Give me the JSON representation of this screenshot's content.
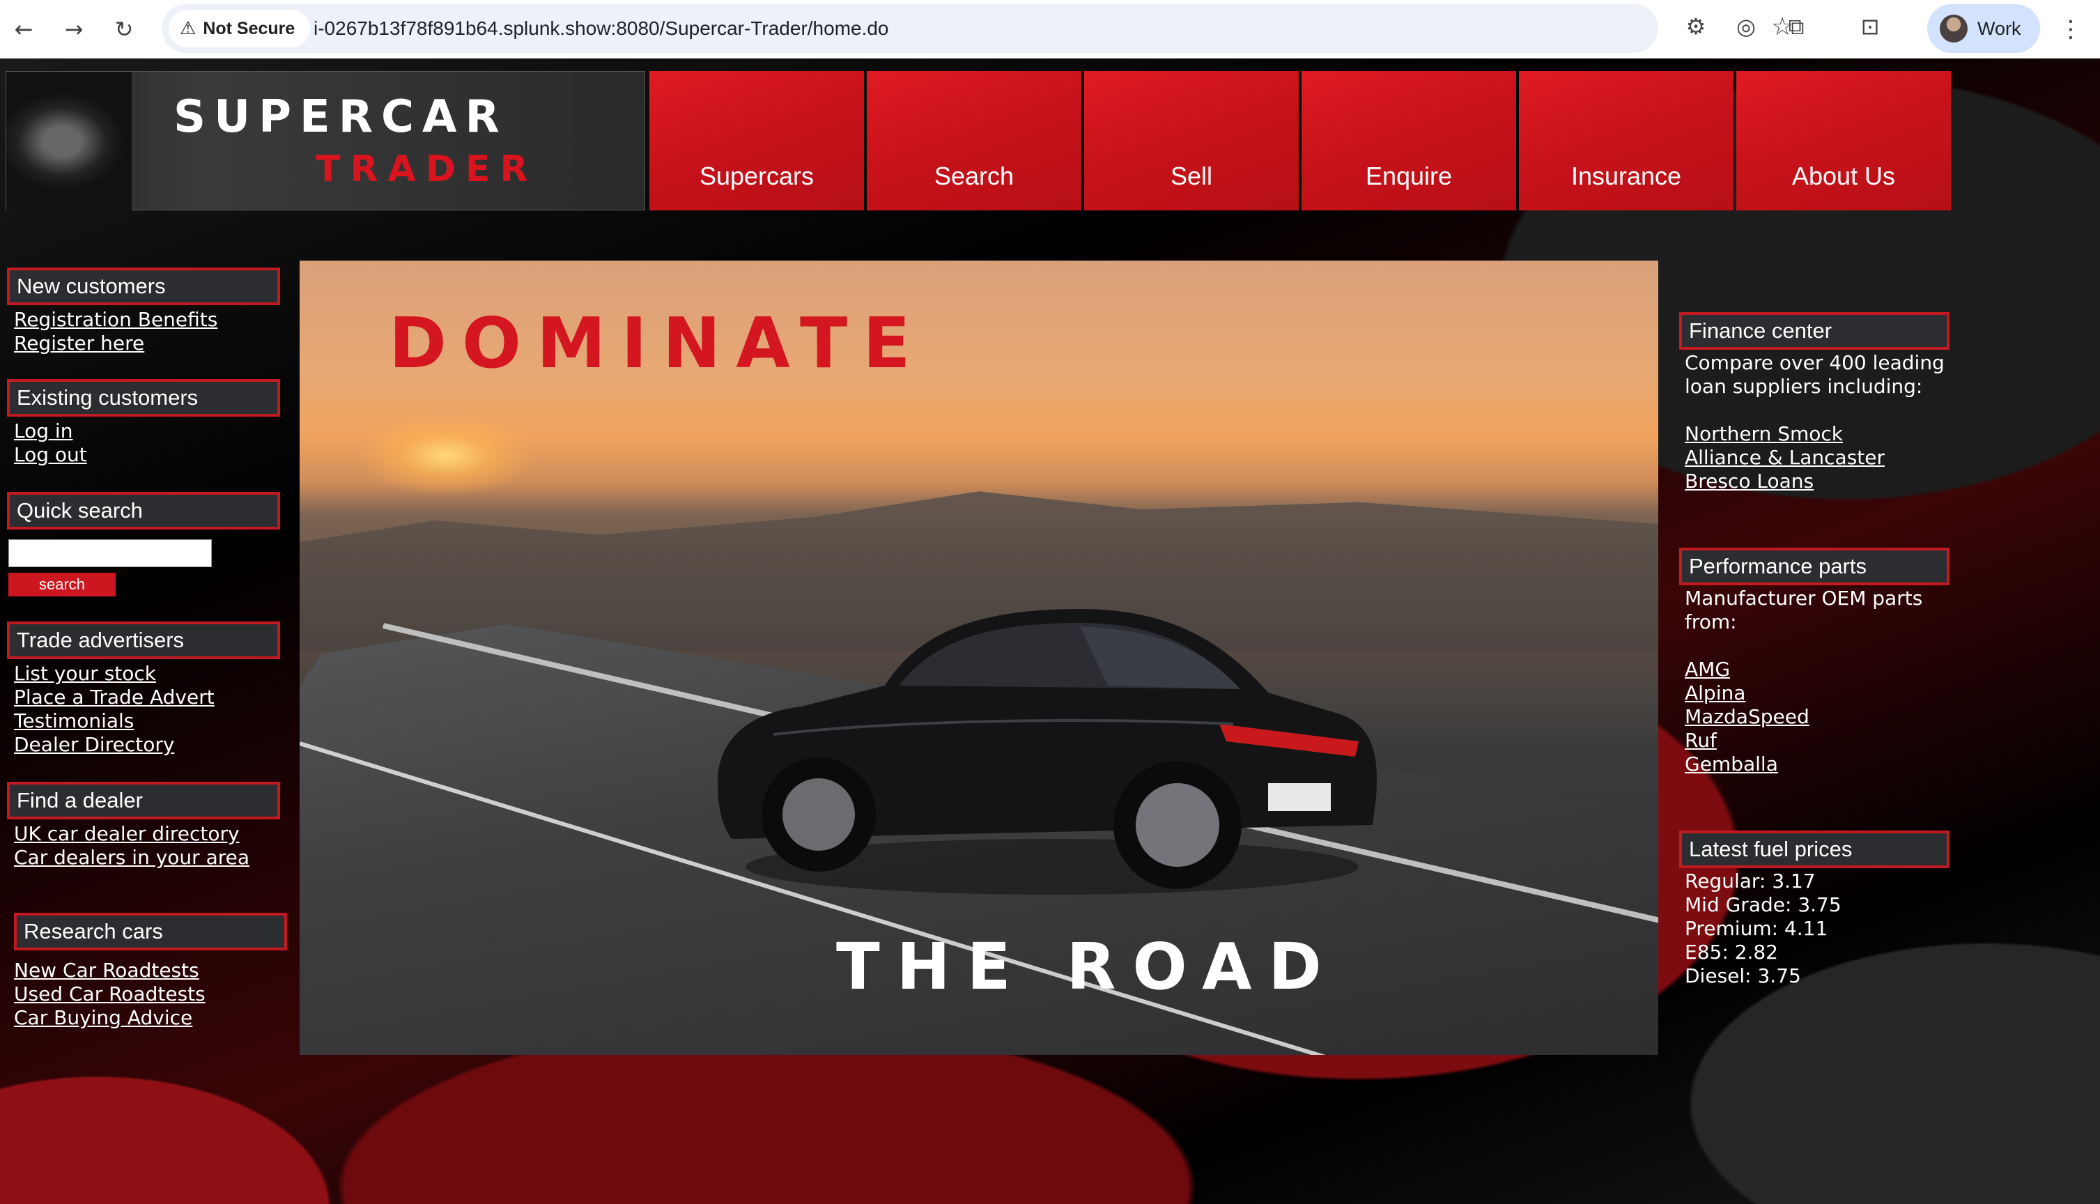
{
  "browser": {
    "security_label": "Not Secure",
    "url": "i-0267b13f78f891b64.splunk.show:8080/Supercar-Trader/home.do",
    "profile_name": "Work",
    "icons": [
      "back-icon",
      "forward-icon",
      "reload-icon",
      "warning-icon",
      "star-icon",
      "extension-icons",
      "menu-icon"
    ]
  },
  "logo": {
    "line1": "SUPERCAR",
    "line2": "TRADER"
  },
  "nav": [
    "Supercars",
    "Search",
    "Sell",
    "Enquire",
    "Insurance",
    "About Us"
  ],
  "left": {
    "new_customers": {
      "title": "New customers",
      "links": [
        "Registration Benefits",
        "Register here"
      ]
    },
    "existing_customers": {
      "title": "Existing customers",
      "links": [
        "Log in",
        "Log out"
      ]
    },
    "quick_search": {
      "title": "Quick search",
      "value": "",
      "button": "search"
    },
    "trade_advertisers": {
      "title": "Trade advertisers",
      "links": [
        "List your stock",
        "Place a Trade Advert",
        "Testimonials",
        "Dealer Directory"
      ]
    },
    "find_dealer": {
      "title": "Find a dealer",
      "links": [
        "UK car dealer directory",
        "Car dealers in your area"
      ]
    },
    "research_cars": {
      "title": "Research cars",
      "links": [
        "New Car Roadtests",
        "Used Car Roadtests",
        "Car Buying Advice"
      ]
    }
  },
  "hero": {
    "line1": "DOMINATE",
    "line2": "THE ROAD"
  },
  "right": {
    "finance": {
      "title": "Finance center",
      "text1": "Compare over 400 leading",
      "text2": "loan suppliers including:",
      "links": [
        "Northern Smock",
        "Alliance & Lancaster",
        "Bresco Loans"
      ]
    },
    "performance": {
      "title": "Performance parts",
      "text1": "Manufacturer OEM parts",
      "text2": "from:",
      "links": [
        "AMG",
        "Alpina",
        "MazdaSpeed",
        "Ruf",
        "Gemballa"
      ]
    },
    "fuel": {
      "title": "Latest fuel prices",
      "prices": [
        "Regular: 3.17",
        "Mid Grade: 3.75",
        "Premium: 4.11",
        "E85: 2.82",
        "Diesel: 3.75"
      ]
    }
  },
  "colors": {
    "brand_red": "#d3161f",
    "box_header_bg": "#2c2d30",
    "box_border": "#c31a22"
  }
}
